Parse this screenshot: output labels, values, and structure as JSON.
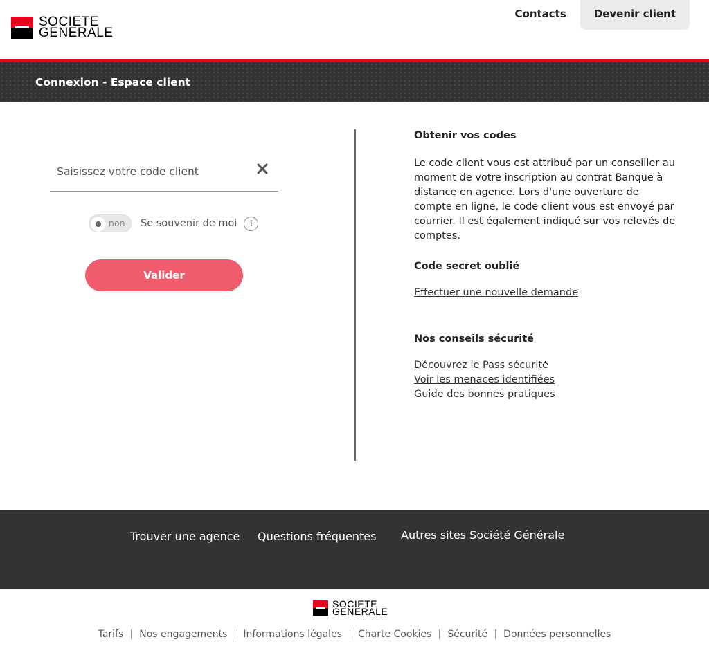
{
  "header": {
    "logo_line1": "SOCIETE",
    "logo_line2": "GENERALE",
    "nav": {
      "contacts": "Contacts",
      "devenir_client": "Devenir client"
    }
  },
  "banner": {
    "title": "Connexion - Espace client"
  },
  "login": {
    "code_placeholder": "Saisissez votre code client",
    "remember_toggle_state": "non",
    "remember_label": "Se souvenir de moi",
    "info_icon_glyph": "i",
    "submit_label": "Valider"
  },
  "help": {
    "codes_title": "Obtenir vos codes",
    "codes_text": "Le code client vous est attribué par un conseiller au moment de votre inscription au contrat Banque à distance en agence. Lors d'une ouverture de compte en ligne, le code client vous est envoyé par courrier. Il est également indiqué sur vos relevés de comptes.",
    "secret_title": "Code secret oublié",
    "secret_link": "Effectuer une nouvelle demande",
    "security_title": "Nos conseils sécurité",
    "security_links": [
      "Découvrez le Pass sécurité",
      "Voir les menaces identifiées",
      "Guide des bonnes pratiques"
    ]
  },
  "footer": {
    "links": [
      "Trouver une agence",
      "Questions fréquentes",
      "Autres sites Société Générale"
    ],
    "logo_line1": "SOCIETE",
    "logo_line2": "GENERALE",
    "legal": [
      "Tarifs",
      "Nos engagements",
      "Informations légales",
      "Charte Cookies",
      "Sécurité",
      "Données personnelles"
    ]
  },
  "colors": {
    "brand_red": "#e9041e",
    "button": "#f05b6d",
    "dark_band": "#333333"
  }
}
